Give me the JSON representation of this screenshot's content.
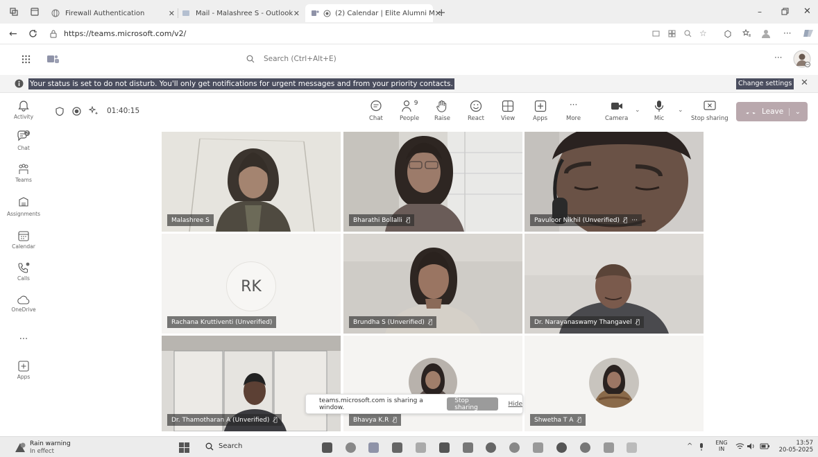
{
  "browser": {
    "tabs": [
      {
        "title": "Firewall Authentication"
      },
      {
        "title": "Mail - Malashree S - Outlook"
      },
      {
        "title": "(2) Calendar | Elite Alumni M"
      }
    ],
    "url": "https://teams.microsoft.com/v2/"
  },
  "teams": {
    "search_placeholder": "Search (Ctrl+Alt+E)",
    "banner_text": "Your status is set to do not disturb. You'll only get notifications for urgent messages and from your priority contacts.",
    "banner_button": "Change settings",
    "rail": [
      {
        "label": "Activity",
        "icon": "bell-icon"
      },
      {
        "label": "Chat",
        "icon": "chat-icon",
        "badge": "2"
      },
      {
        "label": "Teams",
        "icon": "teams-icon"
      },
      {
        "label": "Assignments",
        "icon": "assignments-icon"
      },
      {
        "label": "Calendar",
        "icon": "calendar-icon"
      },
      {
        "label": "Calls",
        "icon": "phone-icon"
      },
      {
        "label": "OneDrive",
        "icon": "cloud-icon"
      },
      {
        "label": "...",
        "icon": "more-icon"
      },
      {
        "label": "Apps",
        "icon": "apps-icon"
      }
    ]
  },
  "meeting": {
    "timer": "01:40:15",
    "people_count": "9",
    "toolbar": [
      {
        "label": "Chat",
        "icon": "chat-icon"
      },
      {
        "label": "People",
        "icon": "people-icon"
      },
      {
        "label": "Raise",
        "icon": "hand-icon"
      },
      {
        "label": "React",
        "icon": "smile-icon"
      },
      {
        "label": "View",
        "icon": "view-icon"
      },
      {
        "label": "Apps",
        "icon": "apps-icon"
      },
      {
        "label": "More",
        "icon": "more-icon"
      },
      {
        "label": "Camera",
        "icon": "camera-icon"
      },
      {
        "label": "Mic",
        "icon": "mic-icon"
      },
      {
        "label": "Stop sharing",
        "icon": "share-icon"
      }
    ],
    "leave_label": "Leave",
    "participants": [
      {
        "name": "Malashree S",
        "mic_off": false
      },
      {
        "name": "Bharathi Bollalli",
        "mic_off": true
      },
      {
        "name": "Pavuloor Nikhil (Unverified)",
        "mic_off": true
      },
      {
        "name": "Rachana Kruttiventi (Unverified)",
        "mic_off": false,
        "initials": "RK"
      },
      {
        "name": "Brundha S (Unverified)",
        "mic_off": true
      },
      {
        "name": "Dr. Narayanaswamy Thangavel",
        "mic_off": true
      },
      {
        "name": "Dr. Thamotharan A (Unverified)",
        "mic_off": true
      },
      {
        "name": "Bhavya K.R",
        "mic_off": true
      },
      {
        "name": "Shwetha T A",
        "mic_off": true
      }
    ],
    "sharing_bar": {
      "text": "teams.microsoft.com is sharing a window.",
      "stop_label": "Stop sharing",
      "hide_label": "Hide"
    }
  },
  "taskbar": {
    "weather_title": "Rain warning",
    "weather_sub": "In effect",
    "search_label": "Search",
    "lang_top": "ENG",
    "lang_bottom": "IN",
    "time": "13:57",
    "date": "20-05-2025"
  },
  "colors": {
    "accent": "#8e8e9c",
    "leave": "#b9a8ad",
    "banner_highlight": "#4a4d5e"
  }
}
